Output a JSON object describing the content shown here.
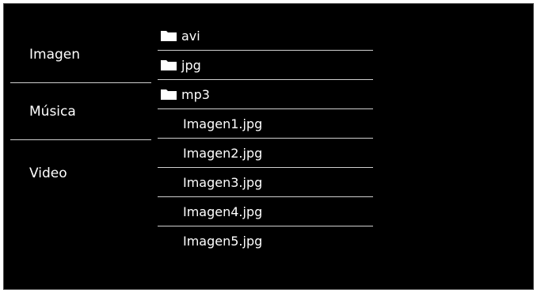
{
  "categories": [
    {
      "label": "Imagen"
    },
    {
      "label": "Música"
    },
    {
      "label": "Video"
    }
  ],
  "files": [
    {
      "label": "avi",
      "icon": "folder-icon"
    },
    {
      "label": "jpg",
      "icon": "folder-icon"
    },
    {
      "label": "mp3",
      "icon": "folder-icon"
    },
    {
      "label": "Imagen1.jpg",
      "icon": ""
    },
    {
      "label": "Imagen2.jpg",
      "icon": ""
    },
    {
      "label": "Imagen3.jpg",
      "icon": ""
    },
    {
      "label": "Imagen4.jpg",
      "icon": ""
    },
    {
      "label": "Imagen5.jpg",
      "icon": ""
    }
  ],
  "colors": {
    "background": "#000000",
    "text": "#ffffff",
    "divider": "#cfcfcf"
  }
}
